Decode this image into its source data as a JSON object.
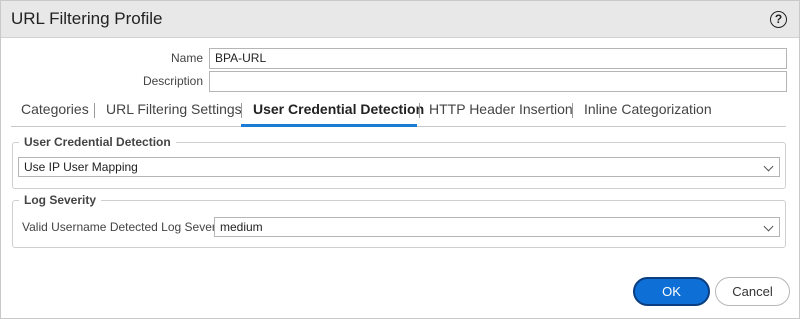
{
  "dialog": {
    "title": "URL Filtering Profile",
    "help_icon": "?"
  },
  "form": {
    "name_label": "Name",
    "name_value": "BPA-URL",
    "description_label": "Description",
    "description_value": ""
  },
  "tabs": [
    {
      "label": "Categories",
      "active": false
    },
    {
      "label": "URL Filtering Settings",
      "active": false
    },
    {
      "label": "User Credential Detection",
      "active": true
    },
    {
      "label": "HTTP Header Insertion",
      "active": false
    },
    {
      "label": "Inline Categorization",
      "active": false
    }
  ],
  "user_credential_detection": {
    "legend": "User Credential Detection",
    "method_value": "Use IP User Mapping"
  },
  "log_severity": {
    "legend": "Log Severity",
    "field_label": "Valid Username Detected Log Severity",
    "value": "medium"
  },
  "buttons": {
    "ok": "OK",
    "cancel": "Cancel"
  },
  "colors": {
    "accent": "#1a7bd2",
    "ok_button": "#0e6fd6",
    "titlebar": "#e8e8e8"
  }
}
